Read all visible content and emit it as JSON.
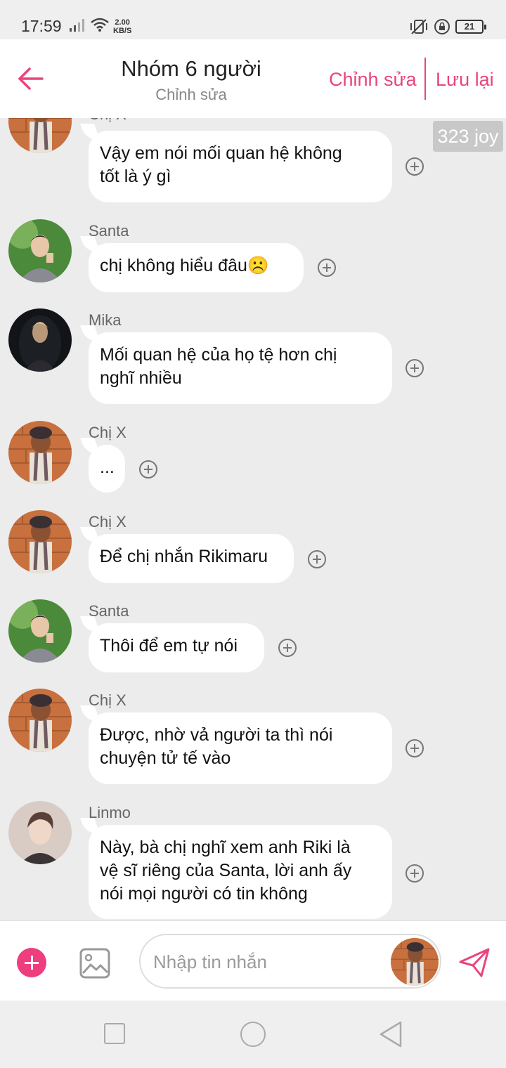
{
  "status_bar": {
    "time": "17:59",
    "speed_value": "2.00",
    "speed_unit": "KB/S",
    "battery": "21"
  },
  "header": {
    "title": "Nhóm 6 người",
    "subtitle": "Chỉnh sửa",
    "edit_label": "Chỉnh sửa",
    "save_label": "Lưu lại"
  },
  "badge": {
    "text": "323 joy"
  },
  "messages": [
    {
      "sender": "Chị X",
      "text_lines": [
        "Vậy em nói mối quan hệ không",
        "tốt là ý gì"
      ],
      "avatar": "chi-x"
    },
    {
      "sender": "Santa",
      "text_lines": [
        " chị không hiểu đâu☹️"
      ],
      "avatar": "santa"
    },
    {
      "sender": "Mika",
      "text_lines": [
        "Mối quan hệ của họ tệ hơn chị",
        "nghĩ nhiều"
      ],
      "avatar": "mika"
    },
    {
      "sender": "Chị X",
      "text_lines": [
        "..."
      ],
      "avatar": "chi-x"
    },
    {
      "sender": "Chị X",
      "text_lines": [
        "Để chị nhắn Rikimaru"
      ],
      "avatar": "chi-x"
    },
    {
      "sender": "Santa",
      "text_lines": [
        "Thôi để em tự nói"
      ],
      "avatar": "santa"
    },
    {
      "sender": "Chị X",
      "text_lines": [
        "Được, nhờ vả người ta thì nói",
        "chuyện tử tế vào"
      ],
      "avatar": "chi-x"
    },
    {
      "sender": "Linmo",
      "text_lines": [
        "Này, bà chị nghĩ xem anh Riki là",
        "vệ sĩ riêng của Santa, lời anh ấy",
        "nói mọi người có tin không"
      ],
      "avatar": "linmo"
    }
  ],
  "input": {
    "placeholder": "Nhập tin nhắn"
  },
  "colors": {
    "accent": "#e8457e",
    "add_button": "#ee3e7e",
    "chat_background": "#ececec",
    "bubble": "#ffffff"
  },
  "icons": {
    "back": "arrow-left-icon",
    "react": "plus-circle-icon",
    "add": "plus-icon",
    "image": "image-icon",
    "send": "send-icon"
  }
}
